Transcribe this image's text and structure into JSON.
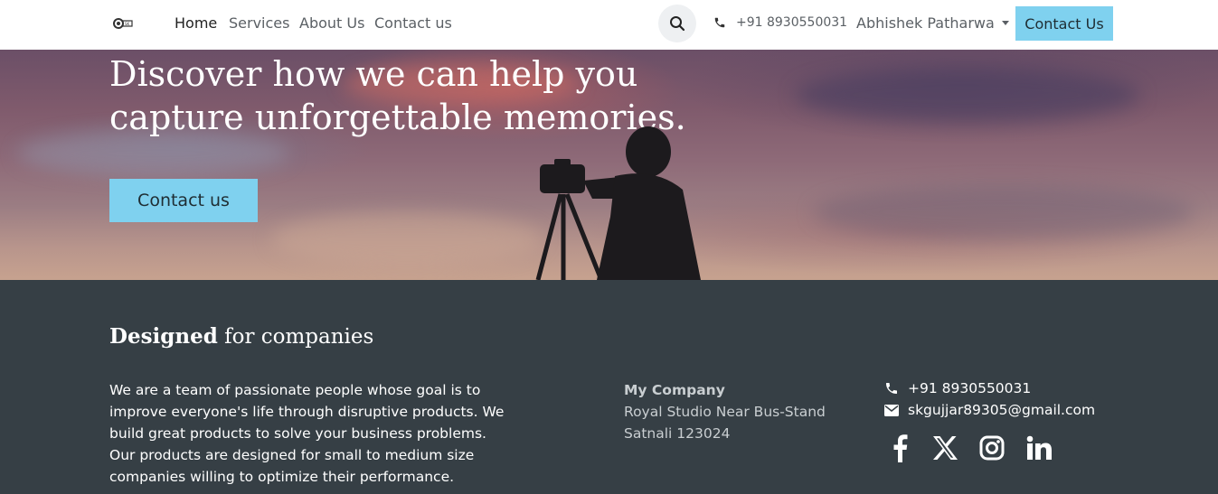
{
  "nav": {
    "links": [
      {
        "label": "Home"
      },
      {
        "label": "Services"
      },
      {
        "label": "About Us"
      },
      {
        "label": "Contact us"
      }
    ],
    "phone": "+91 8930550031",
    "user": "Abhishek Patharwa",
    "cta": "Contact Us"
  },
  "hero": {
    "title_line1": "Discover how we can help you",
    "title_line2": "capture unforgettable memories.",
    "button": "Contact us"
  },
  "footer": {
    "heading_bold": "Designed",
    "heading_rest": " for companies",
    "paragraph": "We are a team of passionate people whose goal is to improve everyone's life through disruptive products. We build great products to solve your business problems. Our products are designed for small to medium size companies willing to optimize their performance.",
    "company_name": "My Company",
    "address_line1": "Royal Studio Near Bus-Stand",
    "address_line2": "Satnali 123024",
    "phone": "+91 8930550031",
    "email": "skgujjar89305@gmail.com"
  },
  "icons": {
    "search": "search-icon",
    "phone": "phone-icon",
    "email": "envelope-icon",
    "social": [
      "facebook-icon",
      "x-twitter-icon",
      "instagram-icon",
      "linkedin-icon"
    ]
  },
  "colors": {
    "accent": "#7fd1ef",
    "footer_bg": "#363f45",
    "nav_text": "#5b6065"
  }
}
